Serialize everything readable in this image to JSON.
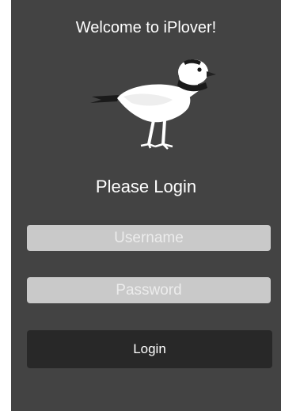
{
  "app": {
    "title": "Welcome to iPlover!",
    "logo_icon": "piping-plover-bird-icon",
    "subtitle": "Please Login"
  },
  "form": {
    "username_placeholder": "Username",
    "username_value": "",
    "password_placeholder": "Password",
    "password_value": "",
    "login_label": "Login"
  },
  "colors": {
    "background": "#434343",
    "field_background": "#c9c9c9",
    "button_background": "#282828",
    "text": "#ffffff"
  }
}
